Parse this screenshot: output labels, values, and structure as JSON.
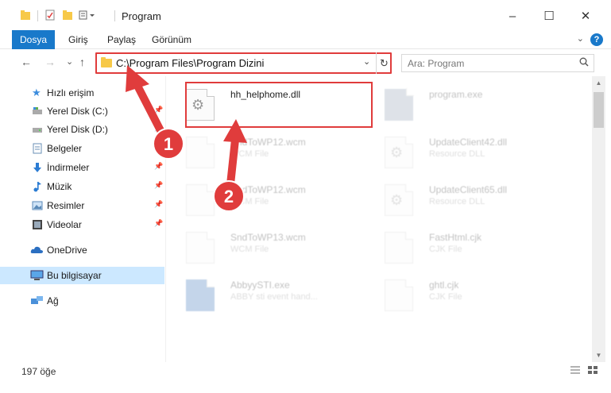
{
  "window": {
    "title": "Program",
    "minimize_glyph": "–",
    "maximize_glyph": "☐",
    "close_glyph": "✕"
  },
  "ribbon": {
    "tabs": [
      {
        "label": "Dosya",
        "active": true
      },
      {
        "label": "Giriş"
      },
      {
        "label": "Paylaş"
      },
      {
        "label": "Görünüm"
      }
    ],
    "help_label": "?",
    "collapse_glyph": "⌄"
  },
  "nav": {
    "back_glyph": "←",
    "forward_glyph": "→",
    "recent_glyph": "⌄",
    "up_glyph": "↑"
  },
  "address": {
    "path": "C:\\Program Files\\Program Dizini",
    "dropdown_glyph": "⌄",
    "refresh_glyph": "↻"
  },
  "search": {
    "placeholder": "Ara: Program",
    "icon": "search-icon"
  },
  "sidebar": {
    "items": [
      {
        "label": "Hızlı erişim",
        "icon": "star-icon",
        "pinned": false
      },
      {
        "label": "Yerel Disk (C:)",
        "icon": "drive-icon",
        "pinned": true
      },
      {
        "label": "Yerel Disk (D:)",
        "icon": "drive-icon",
        "pinned": true
      },
      {
        "label": "Belgeler",
        "icon": "documents-icon",
        "pinned": true
      },
      {
        "label": "İndirmeler",
        "icon": "downloads-icon",
        "pinned": true
      },
      {
        "label": "Müzik",
        "icon": "music-icon",
        "pinned": true
      },
      {
        "label": "Resimler",
        "icon": "pictures-icon",
        "pinned": true
      },
      {
        "label": "Videolar",
        "icon": "videos-icon",
        "pinned": true
      },
      {
        "label": "OneDrive",
        "icon": "cloud-icon",
        "pinned": false
      },
      {
        "label": "Bu bilgisayar",
        "icon": "computer-icon",
        "pinned": false,
        "selected": true
      },
      {
        "label": "Ağ",
        "icon": "network-icon",
        "pinned": false
      }
    ],
    "pin_glyph": "📌"
  },
  "files": [
    {
      "name": "hh_helphome.dll",
      "type": "",
      "highlighted": true
    },
    {
      "name": "program.exe",
      "type": ""
    },
    {
      "name": "SndToWP12.wcm",
      "type": "WCM File"
    },
    {
      "name": "UpdateClient42.dll",
      "type": "Resource DLL"
    },
    {
      "name": "SndToWP12.wcm",
      "type": "WCM File"
    },
    {
      "name": "UpdateClient65.dll",
      "type": "Resource DLL"
    },
    {
      "name": "SndToWP13.wcm",
      "type": "WCM File"
    },
    {
      "name": "FastHtml.cjk",
      "type": "CJK File"
    },
    {
      "name": "AbbyySTI.exe",
      "type": "ABBY sti event hand..."
    },
    {
      "name": "ghtl.cjk",
      "type": "CJK File"
    }
  ],
  "annotations": {
    "badge_1": "1",
    "badge_2": "2",
    "color": "#e03c3c"
  },
  "status": {
    "item_count": "197 öğe"
  }
}
